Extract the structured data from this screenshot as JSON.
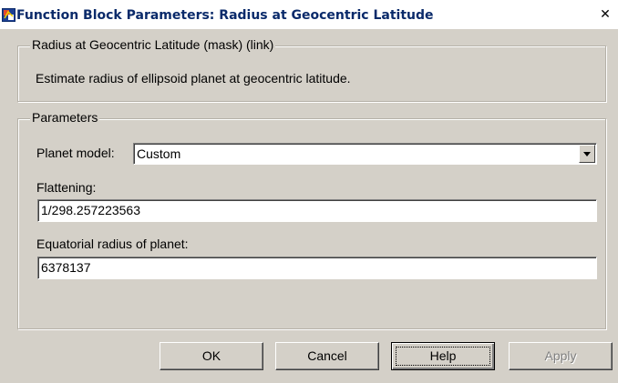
{
  "window": {
    "title": "Function Block Parameters: Radius at Geocentric Latitude",
    "close_glyph": "✕"
  },
  "description_group": {
    "legend": "Radius at Geocentric Latitude (mask) (link)",
    "text": "Estimate radius of ellipsoid planet at geocentric latitude."
  },
  "parameters_group": {
    "legend": "Parameters",
    "planet_model": {
      "label": "Planet model:",
      "value": "Custom"
    },
    "flattening": {
      "label": "Flattening:",
      "value": "1/298.257223563"
    },
    "equatorial_radius": {
      "label": "Equatorial radius of planet:",
      "value": "6378137"
    }
  },
  "buttons": {
    "ok": "OK",
    "cancel": "Cancel",
    "help": "Help",
    "apply": "Apply"
  },
  "colors": {
    "dialog_bg": "#d4d0c8",
    "title_text": "#0a2a6a",
    "disabled_text": "#808080"
  }
}
